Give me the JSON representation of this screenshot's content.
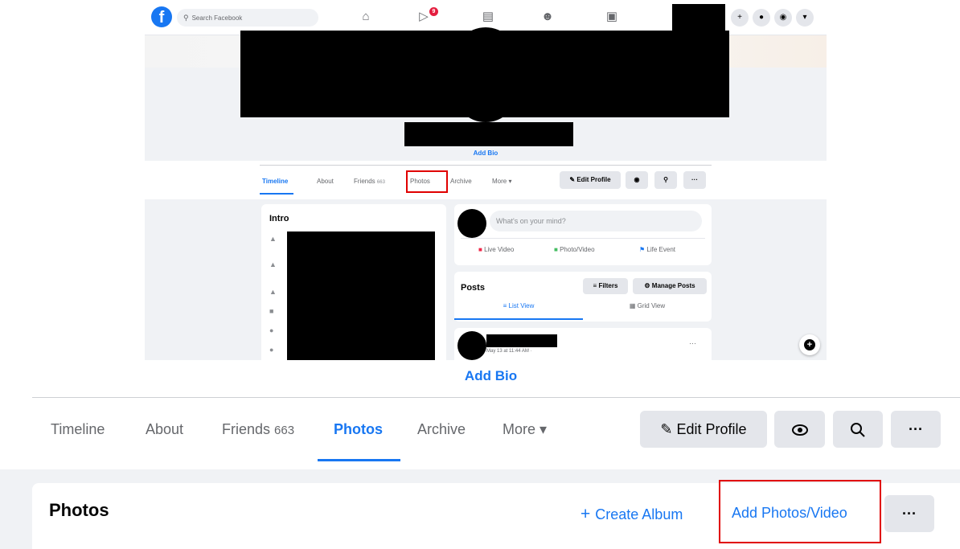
{
  "top_screenshot": {
    "search": {
      "placeholder": "Search Facebook"
    },
    "fb_logo": "f",
    "nav_icons": [
      "home-icon",
      "watch-icon",
      "marketplace-icon",
      "groups-icon",
      "gaming-icon"
    ],
    "watch_badge": "9",
    "header_right_icons": [
      "plus-icon",
      "messenger-icon",
      "bell-icon",
      "caret-down-icon"
    ],
    "add_bio": "Add Bio",
    "tabs": [
      {
        "label": "Timeline"
      },
      {
        "label": "About"
      },
      {
        "label": "Friends",
        "count": "663"
      },
      {
        "label": "Photos"
      },
      {
        "label": "Archive"
      },
      {
        "label": "More ▾"
      }
    ],
    "edit_profile": "Edit Profile",
    "intro_title": "Intro",
    "composer_placeholder": "What's on your mind?",
    "composer_actions": [
      "Live Video",
      "Photo/Video",
      "Life Event"
    ],
    "posts_title": "Posts",
    "filters": "Filters",
    "manage_posts": "Manage Posts",
    "list_view": "List View",
    "grid_view": "Grid View",
    "post_date": "May 13 at 11:44 AM ·",
    "more_dots": "···"
  },
  "zoomed": {
    "add_bio": "Add Bio",
    "tabs": {
      "timeline": "Timeline",
      "about": "About",
      "friends": "Friends",
      "friends_count": "663",
      "photos": "Photos",
      "archive": "Archive",
      "more": "More ▾"
    },
    "edit_profile": "Edit Profile",
    "more_dots": "···",
    "photos_section": {
      "heading": "Photos",
      "create_album": "Create Album",
      "add_photos_video": "Add Photos/Video",
      "more_dots": "···"
    }
  },
  "colors": {
    "accent": "#1877f2",
    "highlight_box": "#e00000",
    "button_bg": "#e4e6eb",
    "page_bg": "#f0f2f5"
  }
}
